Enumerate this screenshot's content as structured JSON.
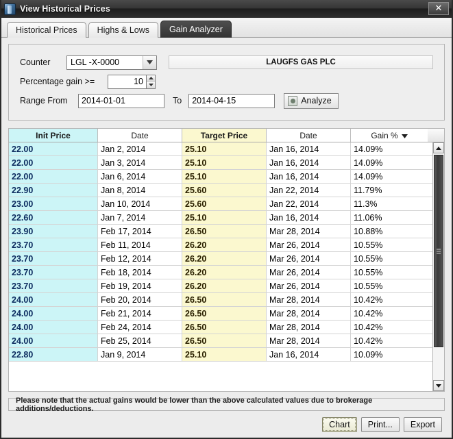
{
  "window": {
    "title": "View Historical Prices",
    "app_icon": "document-stack-icon",
    "close_label": "✕"
  },
  "tabs": [
    {
      "label": "Historical Prices",
      "selected": false,
      "name": "tab-historical-prices"
    },
    {
      "label": "Highs & Lows",
      "selected": false,
      "name": "tab-highs-and-lows"
    },
    {
      "label": "Gain Analyzer",
      "selected": true,
      "name": "tab-gain-analyzer"
    }
  ],
  "criteria": {
    "counter_label": "Counter",
    "counter_value": "LGL -X-0000",
    "counter_dropdown_icon": "chevron-down-icon",
    "company_name": "LAUGFS GAS PLC",
    "percentage_label": "Percentage gain >=",
    "percentage_value": "10",
    "spinner_up_icon": "caret-up-icon",
    "spinner_down_icon": "caret-down-icon",
    "range_from_label": "Range From",
    "range_from_value": "2014-01-01",
    "to_label": "To",
    "range_to_value": "2014-04-15",
    "analyze_label": "Analyze",
    "analyze_icon": "document-icon"
  },
  "table": {
    "columns": [
      {
        "label": "Init Price",
        "name": "column-init-price",
        "sorted": false
      },
      {
        "label": "Date",
        "name": "column-init-date",
        "sorted": false
      },
      {
        "label": "Target Price",
        "name": "column-target-price",
        "sorted": false
      },
      {
        "label": "Date",
        "name": "column-target-date",
        "sorted": false
      },
      {
        "label": "Gain %",
        "name": "column-gain-percent",
        "sorted": true,
        "sort_icon": "caret-down-icon",
        "sort_direction": "descending"
      }
    ],
    "rows": [
      [
        "22.00",
        "Jan 2, 2014",
        "25.10",
        "Jan 16, 2014",
        "14.09%"
      ],
      [
        "22.00",
        "Jan 3, 2014",
        "25.10",
        "Jan 16, 2014",
        "14.09%"
      ],
      [
        "22.00",
        "Jan 6, 2014",
        "25.10",
        "Jan 16, 2014",
        "14.09%"
      ],
      [
        "22.90",
        "Jan 8, 2014",
        "25.60",
        "Jan 22, 2014",
        "11.79%"
      ],
      [
        "23.00",
        "Jan 10, 2014",
        "25.60",
        "Jan 22, 2014",
        "11.3%"
      ],
      [
        "22.60",
        "Jan 7, 2014",
        "25.10",
        "Jan 16, 2014",
        "11.06%"
      ],
      [
        "23.90",
        "Feb 17, 2014",
        "26.50",
        "Mar 28, 2014",
        "10.88%"
      ],
      [
        "23.70",
        "Feb 11, 2014",
        "26.20",
        "Mar 26, 2014",
        "10.55%"
      ],
      [
        "23.70",
        "Feb 12, 2014",
        "26.20",
        "Mar 26, 2014",
        "10.55%"
      ],
      [
        "23.70",
        "Feb 18, 2014",
        "26.20",
        "Mar 26, 2014",
        "10.55%"
      ],
      [
        "23.70",
        "Feb 19, 2014",
        "26.20",
        "Mar 26, 2014",
        "10.55%"
      ],
      [
        "24.00",
        "Feb 20, 2014",
        "26.50",
        "Mar 28, 2014",
        "10.42%"
      ],
      [
        "24.00",
        "Feb 21, 2014",
        "26.50",
        "Mar 28, 2014",
        "10.42%"
      ],
      [
        "24.00",
        "Feb 24, 2014",
        "26.50",
        "Mar 28, 2014",
        "10.42%"
      ],
      [
        "24.00",
        "Feb 25, 2014",
        "26.50",
        "Mar 28, 2014",
        "10.42%"
      ],
      [
        "22.80",
        "Jan 9, 2014",
        "25.10",
        "Jan 16, 2014",
        "10.09%"
      ]
    ],
    "scrollbar": {
      "up_icon": "caret-up-icon",
      "down_icon": "caret-down-icon"
    }
  },
  "footer": {
    "note": "Please note that the actual gains would be lower than the above calculated values due to brokerage additions/deductions.",
    "buttons": [
      {
        "label": "Chart",
        "name": "chart-button",
        "focused": true
      },
      {
        "label": "Print...",
        "name": "print-button",
        "focused": false
      },
      {
        "label": "Export",
        "name": "export-button",
        "focused": false
      }
    ]
  },
  "colors": {
    "init_price_cell": "#ccf5f7",
    "target_price_cell": "#fbf8cf",
    "window_chrome": "#ececec",
    "titlebar": "#2e2e2e",
    "selected_tab": "#3a3a3a"
  }
}
